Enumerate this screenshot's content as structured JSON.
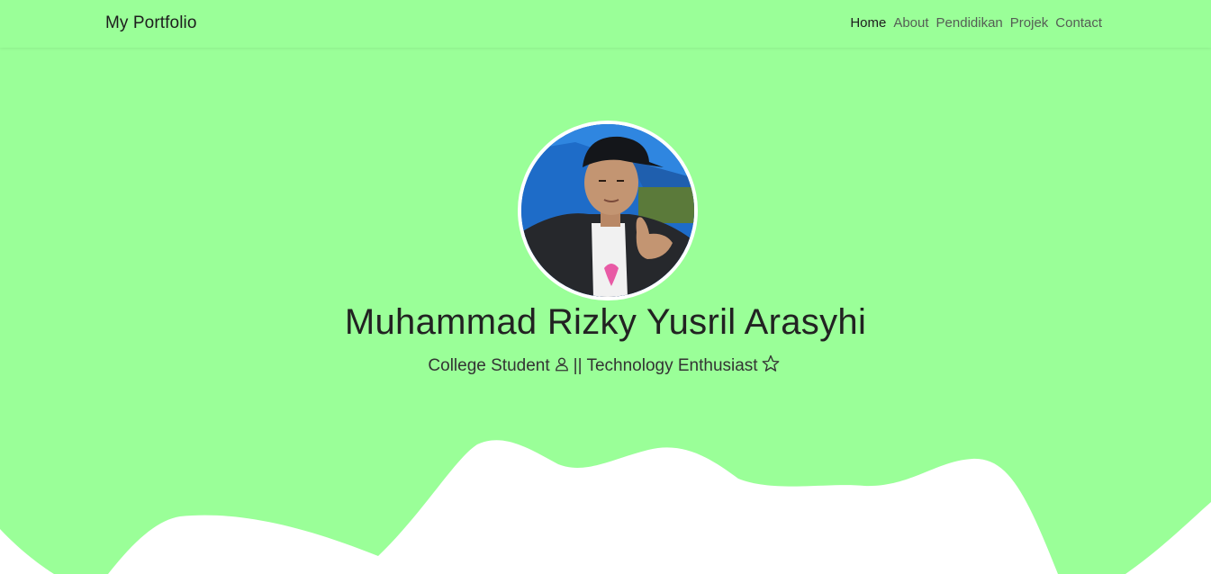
{
  "navbar": {
    "brand": "My Portfolio",
    "links": [
      {
        "label": "Home",
        "active": true
      },
      {
        "label": "About",
        "active": false
      },
      {
        "label": "Pendidikan",
        "active": false
      },
      {
        "label": "Projek",
        "active": false
      },
      {
        "label": "Contact",
        "active": false
      }
    ]
  },
  "hero": {
    "avatar_icon": "profile-photo",
    "name": "Muhammad Rizky Yusril Arasyhi",
    "subtitle_part1": "College Student",
    "subtitle_icon1": "person-icon",
    "subtitle_separator": "||",
    "subtitle_part2": "Technology Enthusiast",
    "subtitle_icon2": "star-icon"
  },
  "colors": {
    "background": "#9aff98",
    "wave": "#ffffff",
    "text": "#212529"
  }
}
